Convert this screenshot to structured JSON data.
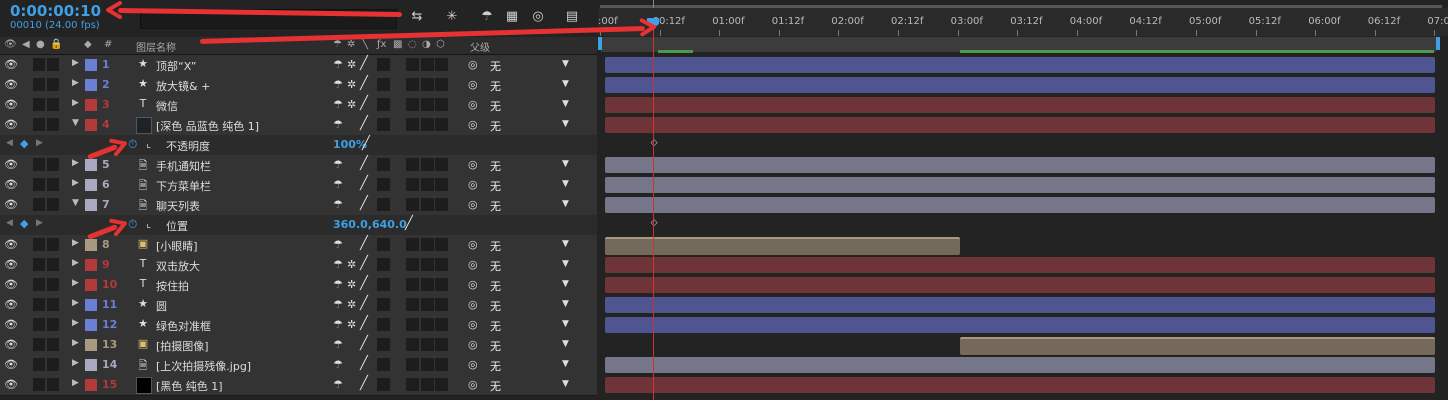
{
  "header": {
    "timecode": "0:00:00:10",
    "frame_info": "00010 (24.00 fps)"
  },
  "columns": {
    "number_label": "#",
    "layer_name_label": "图层名称",
    "parent_label": "父级"
  },
  "ruler": {
    "ticks": [
      ":00f",
      "00:12f",
      "01:00f",
      "01:12f",
      "02:00f",
      "02:12f",
      "03:00f",
      "03:12f",
      "04:00f",
      "04:12f",
      "05:00f",
      "05:12f",
      "06:00f",
      "06:12f",
      "07:0"
    ]
  },
  "rows": [
    {
      "kind": "layer",
      "num": "1",
      "name": "顶部“X”",
      "icon": "star-icon",
      "color": "#6b7fd6",
      "has_cont": true,
      "parent": "无",
      "expanded": false,
      "bar_color": "#4e5590",
      "bar_start": 0.0,
      "bar_end": 1.0
    },
    {
      "kind": "layer",
      "num": "2",
      "name": "放大镜& +",
      "icon": "star-icon",
      "color": "#6b7fd6",
      "has_cont": true,
      "parent": "无",
      "expanded": false,
      "bar_color": "#4e5590",
      "bar_start": 0.0,
      "bar_end": 1.0
    },
    {
      "kind": "layer",
      "num": "3",
      "name": "微信",
      "icon": "text-icon",
      "color": "#b23a3a",
      "has_cont": true,
      "parent": "无",
      "expanded": false,
      "bar_color": "#6e3437",
      "bar_start": 0.0,
      "bar_end": 1.0
    },
    {
      "kind": "layer",
      "num": "4",
      "name": "[深色 品蓝色 纯色 1]",
      "icon": "solid-icon",
      "color": "#b23a3a",
      "has_cont": false,
      "parent": "无",
      "expanded": true,
      "bar_color": "#6e3437",
      "bar_start": 0.0,
      "bar_end": 1.0
    },
    {
      "kind": "prop",
      "name": "不透明度",
      "value": "100%",
      "keyframe_at": 0.061
    },
    {
      "kind": "layer",
      "num": "5",
      "name": "手机通知栏",
      "icon": "file-icon",
      "color": "#a8a8c0",
      "has_cont": false,
      "parent": "无",
      "expanded": false,
      "bar_color": "#76768a",
      "bar_start": 0.0,
      "bar_end": 1.0
    },
    {
      "kind": "layer",
      "num": "6",
      "name": "下方菜单栏",
      "icon": "file-icon",
      "color": "#a8a8c0",
      "has_cont": false,
      "parent": "无",
      "expanded": false,
      "bar_color": "#76768a",
      "bar_start": 0.0,
      "bar_end": 1.0
    },
    {
      "kind": "layer",
      "num": "7",
      "name": "聊天列表",
      "icon": "file-icon",
      "color": "#a8a8c0",
      "has_cont": false,
      "parent": "无",
      "expanded": true,
      "bar_color": "#76768a",
      "bar_start": 0.0,
      "bar_end": 1.0
    },
    {
      "kind": "prop",
      "name": "位置",
      "value": "360.0,640.0",
      "keyframe_at": 0.061
    },
    {
      "kind": "layer",
      "num": "8",
      "name": "[小眼睛]",
      "icon": "comp-icon",
      "color": "#a89a80",
      "has_cont": false,
      "parent": "无",
      "expanded": false,
      "bar_color": "#74695a",
      "bar_start": 0.0,
      "bar_end": 0.428
    },
    {
      "kind": "layer",
      "num": "9",
      "name": "双击放大",
      "icon": "text-icon",
      "color": "#b23a3a",
      "has_cont": true,
      "parent": "无",
      "expanded": false,
      "bar_color": "#6e3437",
      "bar_start": 0.0,
      "bar_end": 1.0
    },
    {
      "kind": "layer",
      "num": "10",
      "name": "按住拍",
      "icon": "text-icon",
      "color": "#b23a3a",
      "has_cont": true,
      "parent": "无",
      "expanded": false,
      "bar_color": "#6e3437",
      "bar_start": 0.0,
      "bar_end": 1.0
    },
    {
      "kind": "layer",
      "num": "11",
      "name": "圆",
      "icon": "star-icon",
      "color": "#6b7fd6",
      "has_cont": true,
      "parent": "无",
      "expanded": false,
      "bar_color": "#4e5590",
      "bar_start": 0.0,
      "bar_end": 1.0
    },
    {
      "kind": "layer",
      "num": "12",
      "name": "绿色对准框",
      "icon": "star-icon",
      "color": "#6b7fd6",
      "has_cont": true,
      "parent": "无",
      "expanded": false,
      "bar_color": "#4e5590",
      "bar_start": 0.0,
      "bar_end": 1.0
    },
    {
      "kind": "layer",
      "num": "13",
      "name": "[拍摄图像]",
      "icon": "comp-icon",
      "color": "#a89a80",
      "has_cont": false,
      "parent": "无",
      "expanded": false,
      "bar_color": "#74695a",
      "bar_start": 0.428,
      "bar_end": 1.0
    },
    {
      "kind": "layer",
      "num": "14",
      "name": "[上次拍摄残像.jpg]",
      "icon": "file-icon",
      "color": "#a8a8c0",
      "has_cont": false,
      "parent": "无",
      "expanded": false,
      "bar_color": "#76768a",
      "bar_start": 0.0,
      "bar_end": 1.0
    },
    {
      "kind": "layer",
      "num": "15",
      "name": "[黑色 纯色 1]",
      "icon": "solid-black-icon",
      "color": "#b23a3a",
      "has_cont": false,
      "parent": "无",
      "expanded": false,
      "bar_color": "#6e3437",
      "bar_start": 0.0,
      "bar_end": 1.0
    }
  ],
  "colors": {
    "accent": "#3fa0e6",
    "cti": "#d23030",
    "annotation_arrow": "#e63232"
  },
  "current_time_fraction": 0.061
}
